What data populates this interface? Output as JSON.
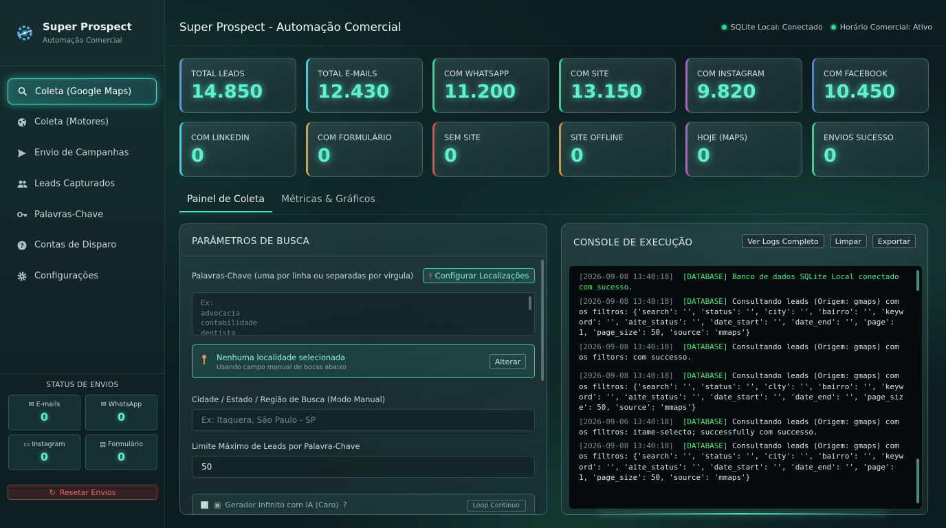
{
  "brand": {
    "title": "Super Prospect",
    "subtitle": "Automação Comercial"
  },
  "sidebar": {
    "items": [
      {
        "label": "Coleta (Google Maps)",
        "icon": "search-icon",
        "active": true
      },
      {
        "label": "Coleta (Motores)",
        "icon": "globe-icon"
      },
      {
        "label": "Envio de Campanhas",
        "icon": "send-icon"
      },
      {
        "label": "Leads Capturados",
        "icon": "users-icon"
      },
      {
        "label": "Palavras-Chave",
        "icon": "key-icon"
      },
      {
        "label": "Contas de Disparo",
        "icon": "help-icon"
      },
      {
        "label": "Configurações",
        "icon": "gear-icon"
      }
    ]
  },
  "send_status": {
    "title": "STATUS DE ENVIOS",
    "items": [
      {
        "label": "E-mails",
        "value": "0",
        "icon": "mail-icon"
      },
      {
        "label": "WhatsApp",
        "value": "0",
        "icon": "mail-icon"
      },
      {
        "label": "Instagram",
        "value": "0",
        "icon": "camera-icon"
      },
      {
        "label": "Formulário",
        "value": "0",
        "icon": "document-icon"
      }
    ],
    "reset_label": "Resetar Envios"
  },
  "header": {
    "title": "Super Prospect - Automação Comercial",
    "status": [
      "SQLite Local: Conectado",
      "Horário Comercial: Ativo"
    ]
  },
  "stats": [
    {
      "label": "TOTAL LEADS",
      "value": "14.850",
      "accent": "#6a8ff0"
    },
    {
      "label": "TOTAL E-MAILS",
      "value": "12.430",
      "accent": "#3fd3e0"
    },
    {
      "label": "COM WHATSAPP",
      "value": "11.200",
      "accent": "#2ed88d"
    },
    {
      "label": "COM SITE",
      "value": "13.150",
      "accent": "#2ed88d"
    },
    {
      "label": "COM INSTAGRAM",
      "value": "9.820",
      "accent": "#c054d8"
    },
    {
      "label": "COM FACEBOOK",
      "value": "10.450",
      "accent": "#4f7fe8"
    },
    {
      "label": "COM LINKEDIN",
      "value": "0",
      "accent": "#3fd3e0"
    },
    {
      "label": "COM FORMULÁRIO",
      "value": "0",
      "accent": "#e0a040"
    },
    {
      "label": "SEM SITE",
      "value": "0",
      "accent": "#e05050"
    },
    {
      "label": "SITE OFFLINE",
      "value": "0",
      "accent": "#e0903a"
    },
    {
      "label": "HOJE (MAPS)",
      "value": "0",
      "accent": "#c054d8"
    },
    {
      "label": "ENVIOS SUCESSO",
      "value": "0",
      "accent": "#2ed88d"
    }
  ],
  "tabs": [
    {
      "label": "Painel de Coleta",
      "active": true
    },
    {
      "label": "Métricas & Gráficos"
    }
  ],
  "params": {
    "title": "PARÂMETROS DE BUSCA",
    "keywords_label": "Palavras-Chave (uma por linha ou separadas por vírgula)",
    "config_button": "Configurar Localizações",
    "keywords_placeholder": "Ex:\nadvocacia\ncontabilidade\ndentista",
    "location_title": "Nenhuma localidade selecionada",
    "location_sub": "Usando campo manual de bocss abaixo",
    "change_button": "Alterar",
    "city_label": "Cidade / Estado / Região de Busca (Modo Manual)",
    "city_placeholder": "Ex: Itaquera, São Paulo - SP",
    "limit_label": "Limite Máximo de Leads por Palavra-Chave",
    "limit_value": "50",
    "infinite_label": "Gerador Infinito com IA (Caro)",
    "infinite_button": "Loop Contínuo"
  },
  "console": {
    "title": "CONSOLE DE EXECUÇÃO",
    "buttons": [
      "Ver Logs Completo",
      "Limpar",
      "Exportar"
    ],
    "lines": [
      {
        "ts": "[2026-09-08 13:40:18]",
        "tag": "[DATABASE]",
        "msg": "Banco de dados SQLite Local conectado com sucesso.",
        "green": true
      },
      {
        "ts": "[2026-09-08 13:40:18]",
        "tag": "[DATABASE]",
        "msg": "Consultando leads (Origem: gmaps) com os filtros: {'search': '', 'status': '', 'city': '', 'bairro': '', 'keyword': '', 'aite_status': '', 'date_start': '', 'date_end': '', 'page': 1, 'page_size': 50, 'source': 'mmaps'}"
      },
      {
        "ts": "[2026-09-08 13:40:18]",
        "tag": "[DATABASE]",
        "msg": "Consultando leads (Origem: gmaps) com os filtors: com successo.",
        "partial_green": true
      },
      {
        "ts": "[2026-09-08 13:40:18]",
        "tag": "[DATABASE]",
        "msg": "Consultando leads (Origem: gmaps) com os flltros: {'search': '', 'status': '', 'clty': '', 'bairro': '', 'keyword': '', 'aite_status': '', 'date_start': '', 'date_end': '', 'page_size': 50, 'source': 'mmaps'}"
      },
      {
        "ts": "[2026-09-06 13:40:18]",
        "tag": "[DATABASE]",
        "msg": "Consultando leads (Origem: gmaps) com os flltros: itame-selecto; successfully com successo.",
        "partial_green2": true
      },
      {
        "ts": "[2026-09-08 13:40:18]",
        "tag": "[DATABASE]",
        "msg": "Consultando leads (Origem: gmaps) com os filtros: {'search': '', 'status': '', 'city': '', 'bairro': '', 'keyword': '', 'aite_status': '', 'date_start': '', 'date_end': '', 'page': 1, 'page_size': 50, 'source': 'mmaps'}"
      }
    ]
  }
}
